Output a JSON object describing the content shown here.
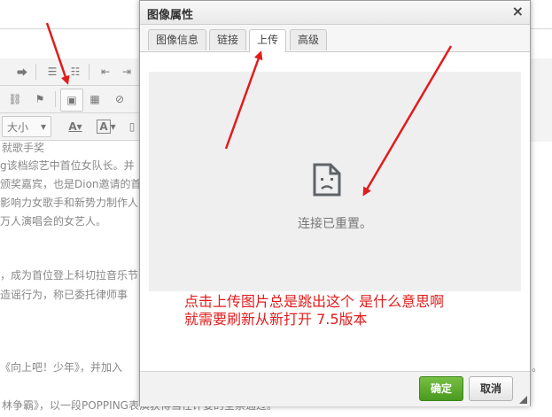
{
  "background": {
    "toolbar_row3_font_size": "大小",
    "lines": [
      "就歌手奖",
      "g该档综艺中首位女队长。并",
      "颁奖嘉宾，也是Dion邀请的首",
      "影响力女歌手和新势力制作人",
      "万人演唱会的女艺人。",
      "，成为首位登上科切拉音乐节",
      "造谣行为，称已委托律师事",
      "《向上吧！少年》，并加入",
      "林争霸》，以一段POPPING表演获得当任评委的全票通过。"
    ],
    "edge_dot": "。"
  },
  "dialog": {
    "title": "图像属性",
    "close": "×",
    "tabs": [
      "图像信息",
      "链接",
      "上传",
      "高级"
    ],
    "active_tab": "上传",
    "error_message": "连接已重置。",
    "annotation_line1": "点击上传图片总是跳出这个 是什么意思啊",
    "annotation_line2": "就需要刷新从新打开 7.5版本",
    "ok_label": "确定",
    "cancel_label": "取消"
  },
  "colors": {
    "arrow": "#e11c1c",
    "ok_button": "#5aa82c"
  }
}
